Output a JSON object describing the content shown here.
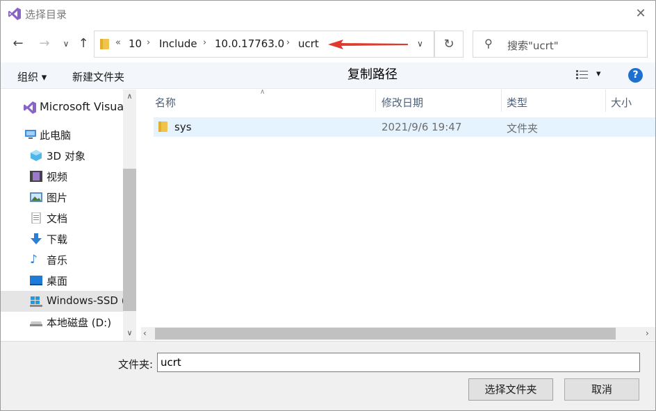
{
  "window": {
    "title": "选择目录"
  },
  "address": {
    "overflow": "«",
    "crumbs": [
      "10",
      "Include",
      "10.0.17763.0",
      "ucrt"
    ]
  },
  "search": {
    "placeholder": "搜索\"ucrt\""
  },
  "toolbar": {
    "organize": "组织 ▾",
    "new_folder": "新建文件夹",
    "view_dropdown": "▾",
    "help": "?"
  },
  "annotation": {
    "text": "复制路径",
    "arrow_color": "#e03a2f"
  },
  "sidebar": {
    "items": [
      {
        "label": "Microsoft Visual",
        "icon": "visual-studio-icon"
      },
      {
        "label": "此电脑",
        "icon": "this-pc-icon"
      },
      {
        "label": "3D 对象",
        "icon": "3d-objects-icon"
      },
      {
        "label": "视频",
        "icon": "videos-icon"
      },
      {
        "label": "图片",
        "icon": "pictures-icon"
      },
      {
        "label": "文档",
        "icon": "documents-icon"
      },
      {
        "label": "下载",
        "icon": "downloads-icon"
      },
      {
        "label": "音乐",
        "icon": "music-icon"
      },
      {
        "label": "桌面",
        "icon": "desktop-icon"
      },
      {
        "label": "Windows-SSD (",
        "icon": "windows-drive-icon"
      },
      {
        "label": "本地磁盘 (D:)",
        "icon": "local-disk-icon"
      }
    ]
  },
  "columns": {
    "name": "名称",
    "modified": "修改日期",
    "type": "类型",
    "size": "大小"
  },
  "files": [
    {
      "name": "sys",
      "modified": "2021/9/6 19:47",
      "type": "文件夹"
    }
  ],
  "footer": {
    "folder_label": "文件夹:",
    "folder_value": "ucrt",
    "select_button": "选择文件夹",
    "cancel_button": "取消"
  },
  "colors": {
    "accent": "#1f6fcf",
    "folder": "#f0c44c",
    "selection": "#e5f3ff"
  }
}
